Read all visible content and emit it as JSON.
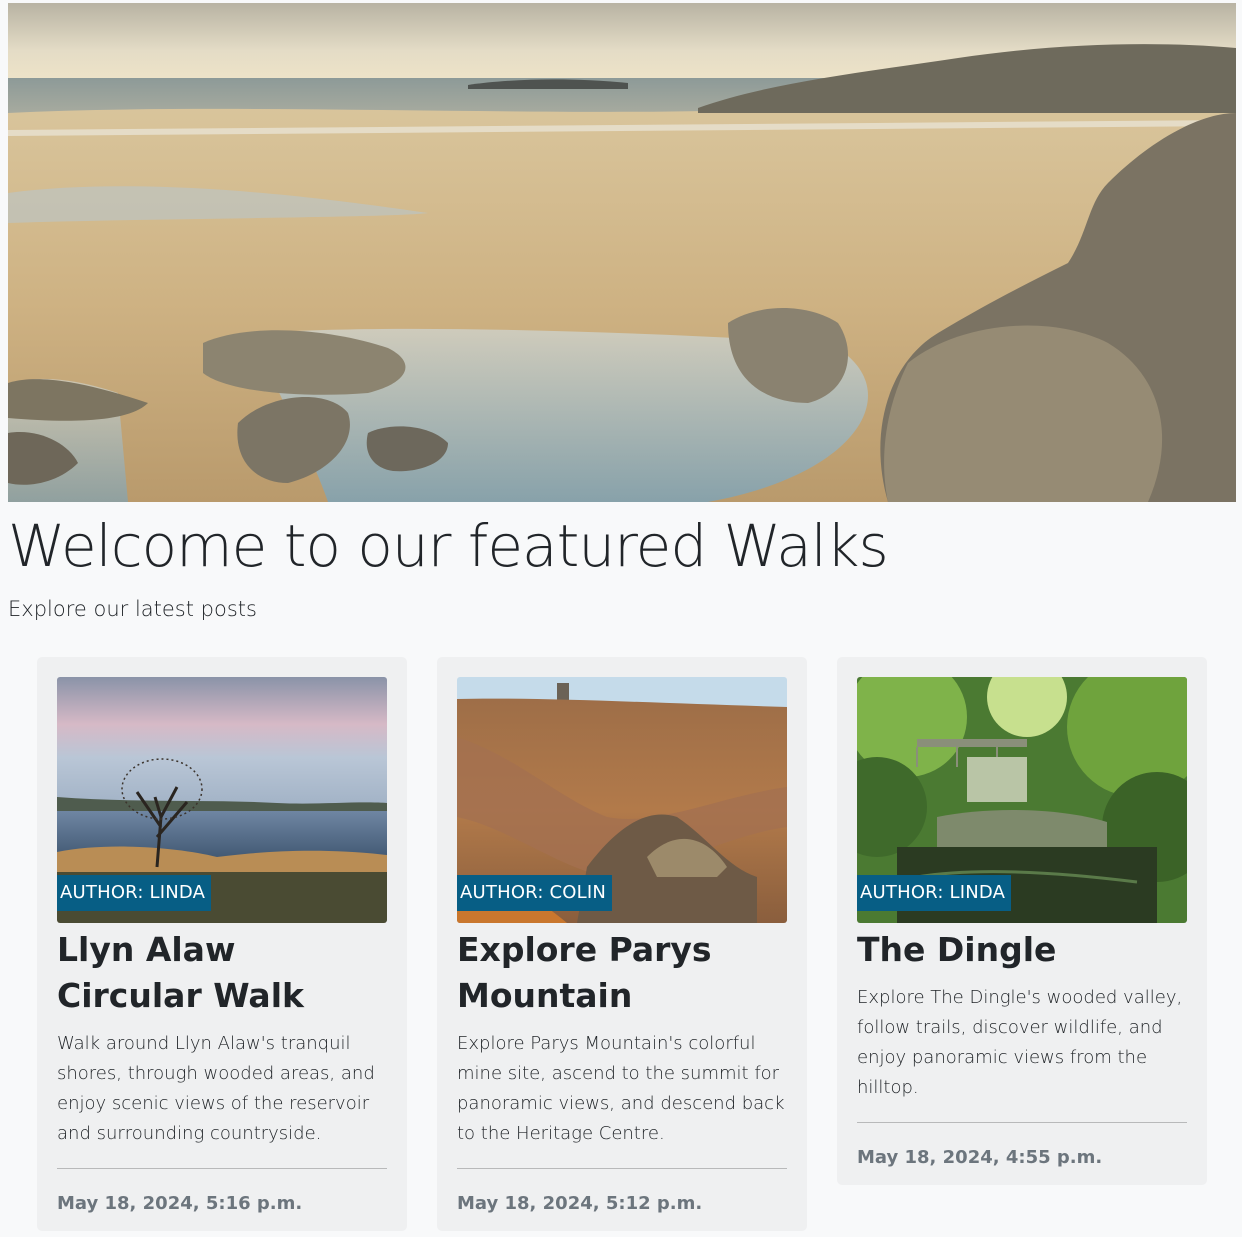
{
  "hero": {
    "image_name": "coastal-beach-rocks-photo"
  },
  "heading": {
    "title": "Welcome to our featured Walks",
    "subtitle": "Explore our latest posts"
  },
  "posts": [
    {
      "image_name": "lake-tree-photo",
      "author": "AUTHOR: LINDA",
      "title": "Llyn Alaw Circular Walk",
      "description": "Walk around Llyn Alaw's tranquil shores, through wooded areas, and enjoy scenic views of the reservoir and surrounding countryside.",
      "date": "May 18, 2024, 5:16 p.m."
    },
    {
      "image_name": "copper-mine-photo",
      "author": "AUTHOR: COLIN",
      "title": "Explore Parys Mountain",
      "description": "Explore Parys Mountain's colorful mine site, ascend to the summit for panoramic views, and descend back to the Heritage Centre.",
      "date": "May 18, 2024, 5:12 p.m."
    },
    {
      "image_name": "wooded-stream-photo",
      "author": "AUTHOR: LINDA",
      "title": "The Dingle",
      "description": "Explore The Dingle's wooded valley, follow trails, discover wildlife, and enjoy panoramic views from the hilltop.",
      "date": "May 18, 2024, 4:55 p.m."
    }
  ],
  "colors": {
    "page_bg": "#f8f9fa",
    "card_bg": "#eff0f1",
    "author_badge": "#075e85",
    "date_text": "#6c757d"
  }
}
